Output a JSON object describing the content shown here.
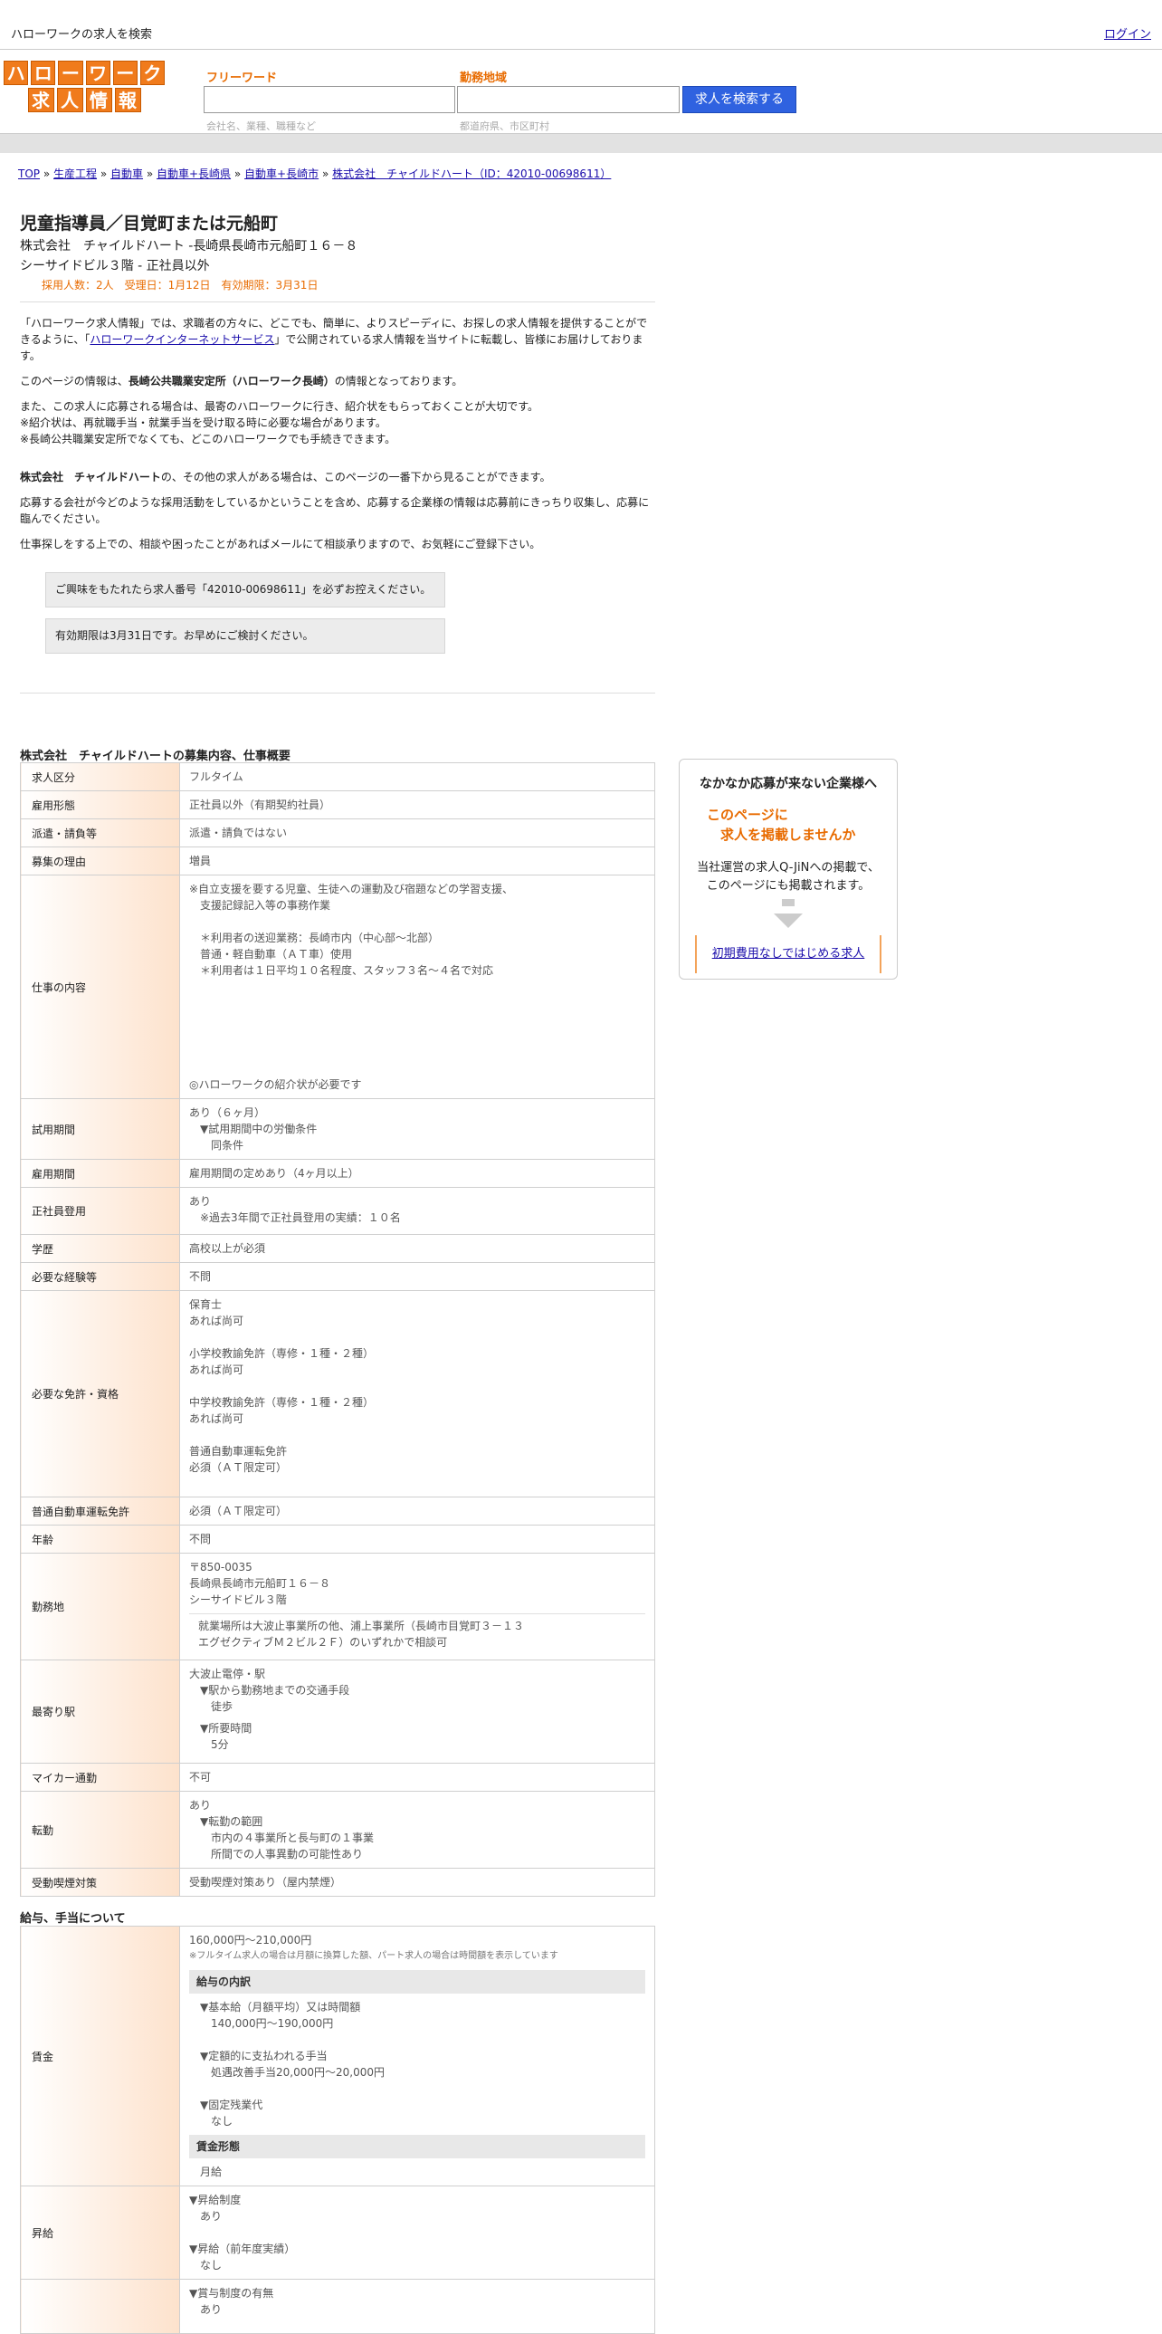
{
  "topbar": {
    "title": "ハローワークの求人を検索",
    "login": "ログイン"
  },
  "logo": {
    "row1": [
      "ハ",
      "ロ",
      "ー",
      "ワ",
      "ー",
      "ク"
    ],
    "row2": [
      "求",
      "人",
      "情",
      "報"
    ]
  },
  "search": {
    "keyword_label": "フリーワード",
    "keyword_hint": "会社名、業種、職種など",
    "area_label": "勤務地域",
    "area_hint": "都道府県、市区町村",
    "button": "求人を検索する"
  },
  "breadcrumbs": [
    "TOP",
    "生産工程",
    "自動車",
    "自動車+長崎県",
    "自動車+長崎市",
    "株式会社　チャイルドハート（ID：42010-00698611）"
  ],
  "job": {
    "title": "児童指導員／目覚町または元船町",
    "line1": "株式会社　チャイルドハート -長崎県長崎市元船町１６－８",
    "line2": "シーサイドビル３階 - 正社員以外",
    "meta": "採用人数：2人　受理日：1月12日　有効期限：3月31日"
  },
  "intro": {
    "p1_a": "「ハローワーク求人情報」では、求職者の方々に、どこでも、簡単に、よりスピーディに、お探しの求人情報を提供することができるように、「",
    "p1_link": "ハローワークインターネットサービス",
    "p1_b": "」で公開されている求人情報を当サイトに転載し、皆様にお届けしております。",
    "p2_a": "このページの情報は、",
    "p2_bold": "長崎公共職業安定所（ハローワーク長崎）",
    "p2_b": "の情報となっております。",
    "p3": "また、この求人に応募される場合は、最寄のハローワークに行き、紹介状をもらっておくことが大切です。\n※紹介状は、再就職手当・就業手当を受け取る時に必要な場合があります。\n※長崎公共職業安定所でなくても、どこのハローワークでも手続きできます。",
    "p4_bold": "株式会社　チャイルドハート",
    "p4": "の、その他の求人がある場合は、このページの一番下から見ることができます。",
    "p5": "応募する会社が今どのような採用活動をしているかということを含め、応募する企業様の情報は応募前にきっちり収集し、応募に臨んでください。",
    "p6": "仕事探しをする上での、相談や困ったことがあればメールにて相談承りますので、お気軽にご登録下さい。",
    "note1": "ご興味をもたれたら求人番号「42010-00698611」を必ずお控えください。",
    "note2": "有効期限は3月31日です。お早めにご検討ください。"
  },
  "section1": {
    "title": "株式会社　チャイルドハートの募集内容、仕事概要",
    "rows": [
      {
        "k": "求人区分",
        "v": "フルタイム"
      },
      {
        "k": "雇用形態",
        "v": "正社員以外（有期契約社員）"
      },
      {
        "k": "派遣・請負等",
        "v": "派遣・請負ではない"
      },
      {
        "k": "募集の理由",
        "v": "増員"
      },
      {
        "k": "仕事の内容",
        "v": "※自立支援を要する児童、生徒への運動及び宿題などの学習支援、\n　支援記録記入等の事務作業\n\n　＊利用者の送迎業務：長崎市内（中心部～北部）\n　普通・軽自動車（ＡＴ車）使用\n　＊利用者は１日平均１０名程度、スタッフ３名～４名で対応\n\n\n\n\n\n\n◎ハローワークの紹介状が必要です"
      },
      {
        "k": "試用期間",
        "v": "あり（６ヶ月）\n　▼試用期間中の労働条件\n　　同条件"
      },
      {
        "k": "雇用期間",
        "v": "雇用期間の定めあり（4ヶ月以上）"
      },
      {
        "k": "正社員登用",
        "v": "あり\n　※過去3年間で正社員登用の実績：１０名"
      },
      {
        "k": "学歴",
        "v": "高校以上が必須"
      },
      {
        "k": "必要な経験等",
        "v": "不問"
      },
      {
        "k": "必要な免許・資格",
        "v": "保育士\nあれば尚可\n\n小学校教諭免許（専修・１種・２種）\nあれば尚可\n\n中学校教諭免許（専修・１種・２種）\nあれば尚可\n\n普通自動車運転免許\n必須（ＡＴ限定可）"
      },
      {
        "k": "普通自動車運転免許",
        "v": "必須（ＡＴ限定可）"
      },
      {
        "k": "年齢",
        "v": "不問"
      },
      {
        "k": "勤務地",
        "v": "〒850-0035\n長崎県長崎市元船町１６－８\nシーサイドビル３階",
        "v2": "就業場所は大波止事業所の他、浦上事業所（長崎市目覚町３－１３\nエグゼクティブＭ２ビル２Ｆ）のいずれかで相談可"
      },
      {
        "k": "最寄り駅",
        "v": "大波止電停・駅\n　▼駅から勤務地までの交通手段\n　　徒歩",
        "v2": "　▼所要時間\n　　5分"
      },
      {
        "k": "マイカー通勤",
        "v": "不可"
      },
      {
        "k": "転勤",
        "v": "あり\n　▼転勤の範囲\n　　市内の４事業所と長与町の１事業\n　　所間での人事異動の可能性あり"
      },
      {
        "k": "受動喫煙対策",
        "v": "受動喫煙対策あり（屋内禁煙）"
      }
    ]
  },
  "section2": {
    "title": "給与、手当について",
    "wage_key": "賃金",
    "wage_range": "160,000円〜210,000円",
    "wage_note": "※フルタイム求人の場合は月額に換算した額、パート求人の場合は時間額を表示しています",
    "breakdown_head": "給与の内訳",
    "breakdown": "▼基本給（月額平均）又は時間額\n　140,000円〜190,000円\n\n▼定額的に支払われる手当\n　処遇改善手当20,000円〜20,000円\n\n▼固定残業代\n　なし",
    "form_head": "賃金形態",
    "form": "月給",
    "raise_key": "昇給",
    "raise": "▼昇給制度\n　あり\n\n▼昇給（前年度実績）\n　なし",
    "bonus": "▼賞与制度の有無\n　あり"
  },
  "side": {
    "t1": "なかなか応募が来ない企業様へ",
    "t2": "このページに\n　求人を掲載しませんか",
    "t3": "当社運営の求人Q-JiNへの掲載で、\nこのページにも掲載されます。",
    "link": "初期費用なしではじめる求人"
  }
}
